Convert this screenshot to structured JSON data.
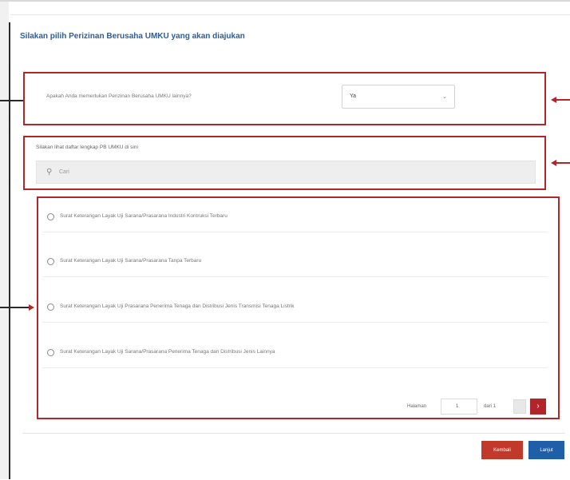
{
  "modal": {
    "title": "Silakan pilih Perizinan Berusaha UMKU yang akan diajukan"
  },
  "question": {
    "label": "Apakah Anda memerlukan Perizinan Berusaha UMKU lainnya?",
    "selected": "Ya",
    "chevron_icon": "chevron-down-icon"
  },
  "search": {
    "label": "Silakan lihat daftar lengkap PB UMKU di sini",
    "placeholder": "Cari",
    "icon": "search-icon"
  },
  "items": [
    {
      "label": "Surat Keterangan Layak Uji Sarana/Prasarana Industri Kontruksi Terbaru"
    },
    {
      "label": "Surat Keterangan Layak Uji Sarana/Prasarana Tanpa Terbaru"
    },
    {
      "label": "Surat Keterangan Layak Uji Prasarana Penerima Tenaga dan Distribusi Jenis Transmisi Tenaga Listrik"
    },
    {
      "label": "Surat Keterangan Layak Uji Sarana/Prasarana Penerima Tenaga dan Distribusi Jenis Lainnya"
    }
  ],
  "pagination": {
    "page_label": "Halaman",
    "page_value": "1",
    "of_label": "dari 1"
  },
  "footer": {
    "cancel_label": "Kembali",
    "submit_label": "Lanjut"
  },
  "colors": {
    "accent_red": "#b1262a",
    "primary_blue": "#1f5fa8",
    "title_blue": "#2c5d9b"
  }
}
